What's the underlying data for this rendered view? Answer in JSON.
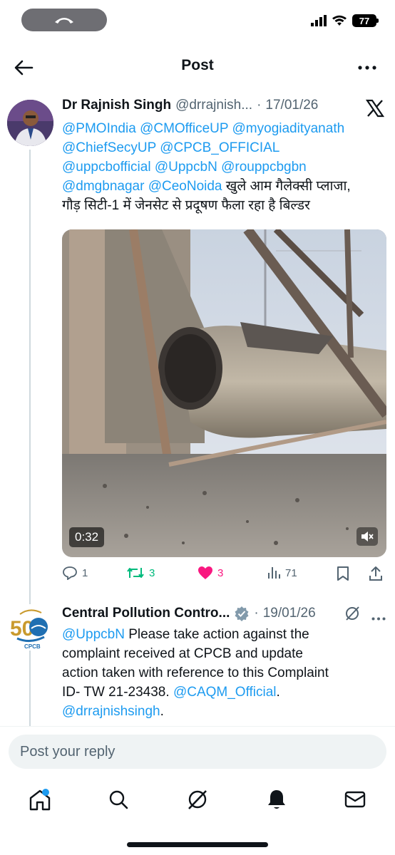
{
  "status_bar": {
    "battery": "77"
  },
  "header": {
    "title": "Post"
  },
  "tweet1": {
    "name": "Dr Rajnish Singh",
    "handle": "@drrajnish...",
    "separator": "·",
    "date": "17/01/26",
    "mentions": [
      "@PMOIndia",
      "@CMOfficeUP",
      "@myogiadityanath",
      "@ChiefSecyUP",
      "@CPCB_OFFICIAL",
      "@uppcbofficial",
      "@UppcbN",
      "@rouppcbgbn",
      "@dmgbnagar",
      "@CeoNoida"
    ],
    "text_hindi_1": "खुले आम गैलेक्सी प्लाजा,",
    "text_hindi_2": "गौड़ सिटी-1 में जेनसेट से प्रदूषण फैला रहा है बिल्डर",
    "video_duration": "0:32",
    "replies": "1",
    "reposts": "3",
    "likes": "3",
    "views": "71"
  },
  "tweet2": {
    "name": "Central Pollution Contro...",
    "separator": "·",
    "date": "19/01/26",
    "avatar_label": "CPCB",
    "avatar_number": "50",
    "mention_start": "@UppcbN",
    "text_1": " Please take action against the",
    "text_2": "complaint received at CPCB and update",
    "text_3": "action taken with reference to this Complaint",
    "text_4": "ID- TW 21-23438. ",
    "mention_caqm": "@CAQM_Official",
    "text_5": ".",
    "mention_end": "@drrajnishsingh",
    "text_6": "."
  },
  "reply": {
    "placeholder": "Post your reply"
  },
  "colors": {
    "link": "#1d9bf0",
    "like": "#f91880",
    "repost": "#00ba7c",
    "muted": "#536471"
  }
}
